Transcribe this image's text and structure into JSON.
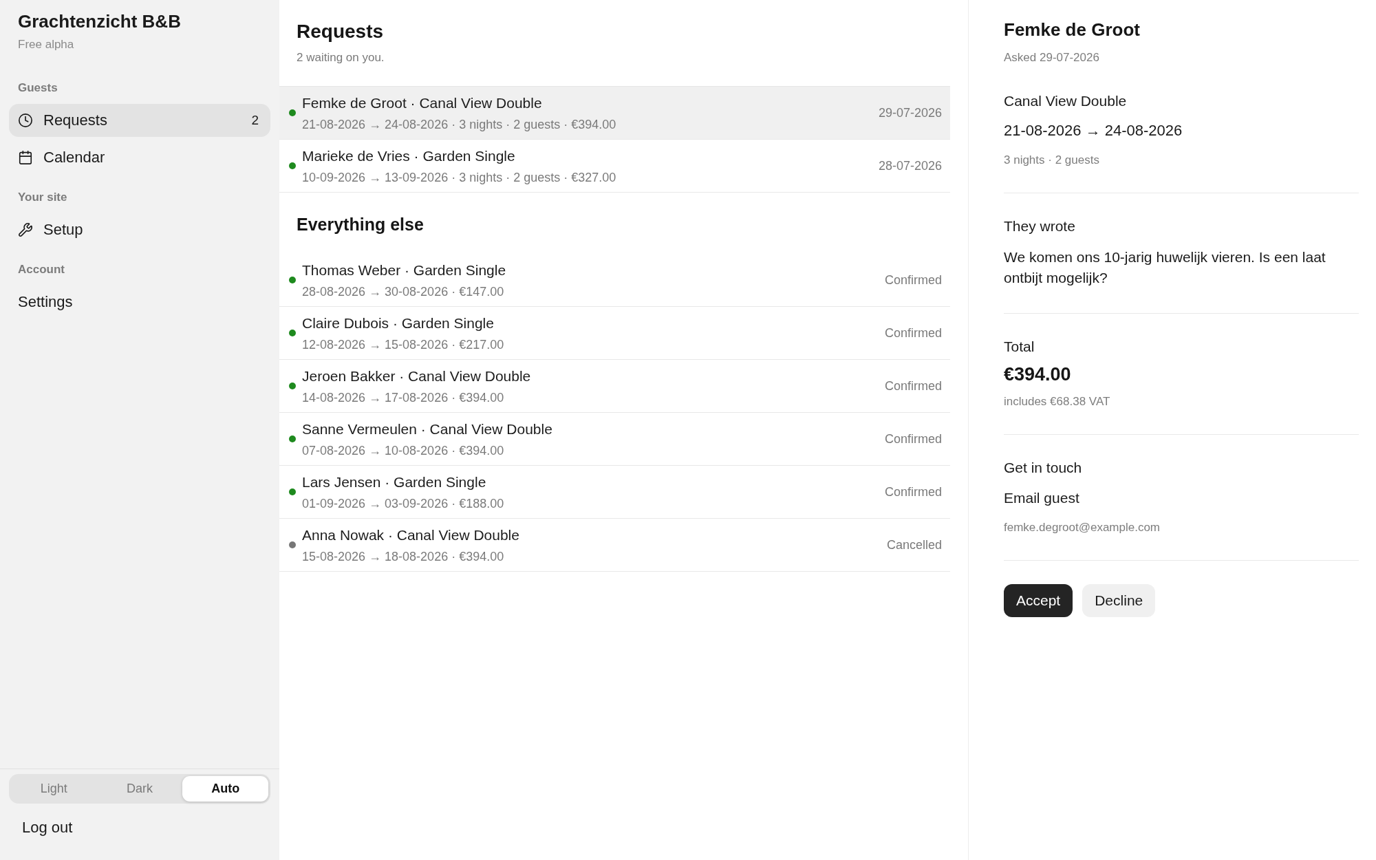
{
  "sidebar": {
    "brand": {
      "title": "Grachtenzicht B&B",
      "plan": "Free alpha"
    },
    "sections": [
      {
        "heading": "Guests",
        "items": [
          {
            "label": "Requests",
            "count": "2",
            "selected": true
          },
          {
            "label": "Calendar",
            "selected": false
          }
        ]
      },
      {
        "heading": "Your site",
        "items": [
          {
            "label": "Setup",
            "selected": false
          }
        ]
      },
      {
        "heading": "Account",
        "items": [
          {
            "label": "Settings",
            "selected": false
          }
        ]
      }
    ],
    "theme_switch": [
      {
        "label": "Light",
        "selected": false
      },
      {
        "label": "Dark",
        "selected": false
      },
      {
        "label": "Auto",
        "selected": true
      }
    ],
    "logout": "Log out"
  },
  "requests": {
    "title": "Requests",
    "subtitle": "2 waiting on you.",
    "rows": [
      {
        "title": "Femke de Groot · Canal View Double",
        "details": "21-08-2026 → 24-08-2026 · 3 nights · 2 guests · €394.00",
        "meta": "29-07-2026",
        "color": "#1e8a1e",
        "selected": true
      },
      {
        "title": "Marieke de Vries · Garden Single",
        "details": "10-09-2026 → 13-09-2026 · 3 nights · 2 guests · €327.00",
        "meta": "28-07-2026",
        "color": "#1e8a1e",
        "selected": false
      }
    ]
  },
  "others": {
    "title": "Everything else",
    "rows": [
      {
        "title": "Thomas Weber · Garden Single",
        "details": "28-08-2026 → 30-08-2026 · €147.00",
        "meta": "Confirmed",
        "color": "#1e8a1e",
        "selected": false
      },
      {
        "title": "Claire Dubois · Garden Single",
        "details": "12-08-2026 → 15-08-2026 · €217.00",
        "meta": "Confirmed",
        "color": "#1e8a1e",
        "selected": false
      },
      {
        "title": "Jeroen Bakker · Canal View Double",
        "details": "14-08-2026 → 17-08-2026 · €394.00",
        "meta": "Confirmed",
        "color": "#1e8a1e",
        "selected": false
      },
      {
        "title": "Sanne Vermeulen · Canal View Double",
        "details": "07-08-2026 → 10-08-2026 · €394.00",
        "meta": "Confirmed",
        "color": "#1e8a1e",
        "selected": false
      },
      {
        "title": "Lars Jensen · Garden Single",
        "details": "01-09-2026 → 03-09-2026 · €188.00",
        "meta": "Confirmed",
        "color": "#1e8a1e",
        "selected": false
      },
      {
        "title": "Anna Nowak · Canal View Double",
        "details": "15-08-2026 → 18-08-2026 · €394.00",
        "meta": "Cancelled",
        "color": "#777777",
        "selected": false
      }
    ]
  },
  "detail": {
    "name": "Femke de Groot",
    "asked": "Asked 29-07-2026",
    "room": "Canal View Double",
    "dates": "21-08-2026 → 24-08-2026",
    "stay": "3 nights · 2 guests",
    "message_heading": "They wrote",
    "message": "We komen ons 10-jarig huwelijk vieren. Is een laat ontbijt mogelijk?",
    "total_heading": "Total",
    "total": "€394.00",
    "vat": "includes €68.38 VAT",
    "contact_heading": "Get in touch",
    "contact_link": "Email guest",
    "email": "femke.degroot@example.com",
    "actions": [
      {
        "label": "Accept",
        "kind": "primary"
      },
      {
        "label": "Decline",
        "kind": "secondary"
      }
    ]
  }
}
